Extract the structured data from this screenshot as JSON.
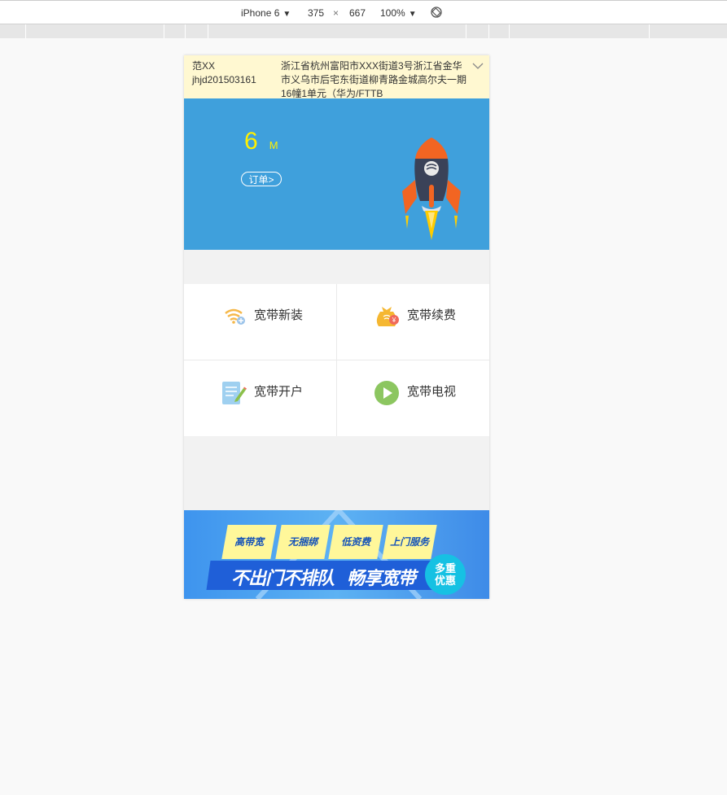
{
  "devtools": {
    "device": "iPhone 6",
    "width": "375",
    "times": "×",
    "height": "667",
    "zoom": "100%"
  },
  "account": {
    "name": "范XX",
    "id": "jhjd201503161",
    "address": "浙江省杭州富阳市XXX街道3号浙江省金华市义乌市后宅东街道柳青路金城高尔夫一期16幢1单元（华为/FTTB"
  },
  "hero": {
    "speed_value": "6",
    "speed_unit": "M",
    "order_label": "订单",
    "rocket_icon": "rocket-icon"
  },
  "services": [
    {
      "label": "宽带新装",
      "icon": "wifi-icon",
      "color": "#f5b84a"
    },
    {
      "label": "宽带续费",
      "icon": "money-bag-icon",
      "color": "#f5b731"
    },
    {
      "label": "宽带开户",
      "icon": "form-edit-icon",
      "color": "#7bbce8"
    },
    {
      "label": "宽带电视",
      "icon": "play-icon",
      "color": "#8cc660"
    }
  ],
  "banner": {
    "tags": [
      "高带宽",
      "无捆绑",
      "低资费",
      "上门服务"
    ],
    "slogan_part1": "不出门不排队",
    "slogan_part2": "畅享宽带",
    "badge_line1": "多重",
    "badge_line2": "优惠"
  },
  "colors": {
    "hero_bg": "#3fa0dc",
    "speed_text": "#fff000",
    "account_bg": "#fff8d1"
  }
}
